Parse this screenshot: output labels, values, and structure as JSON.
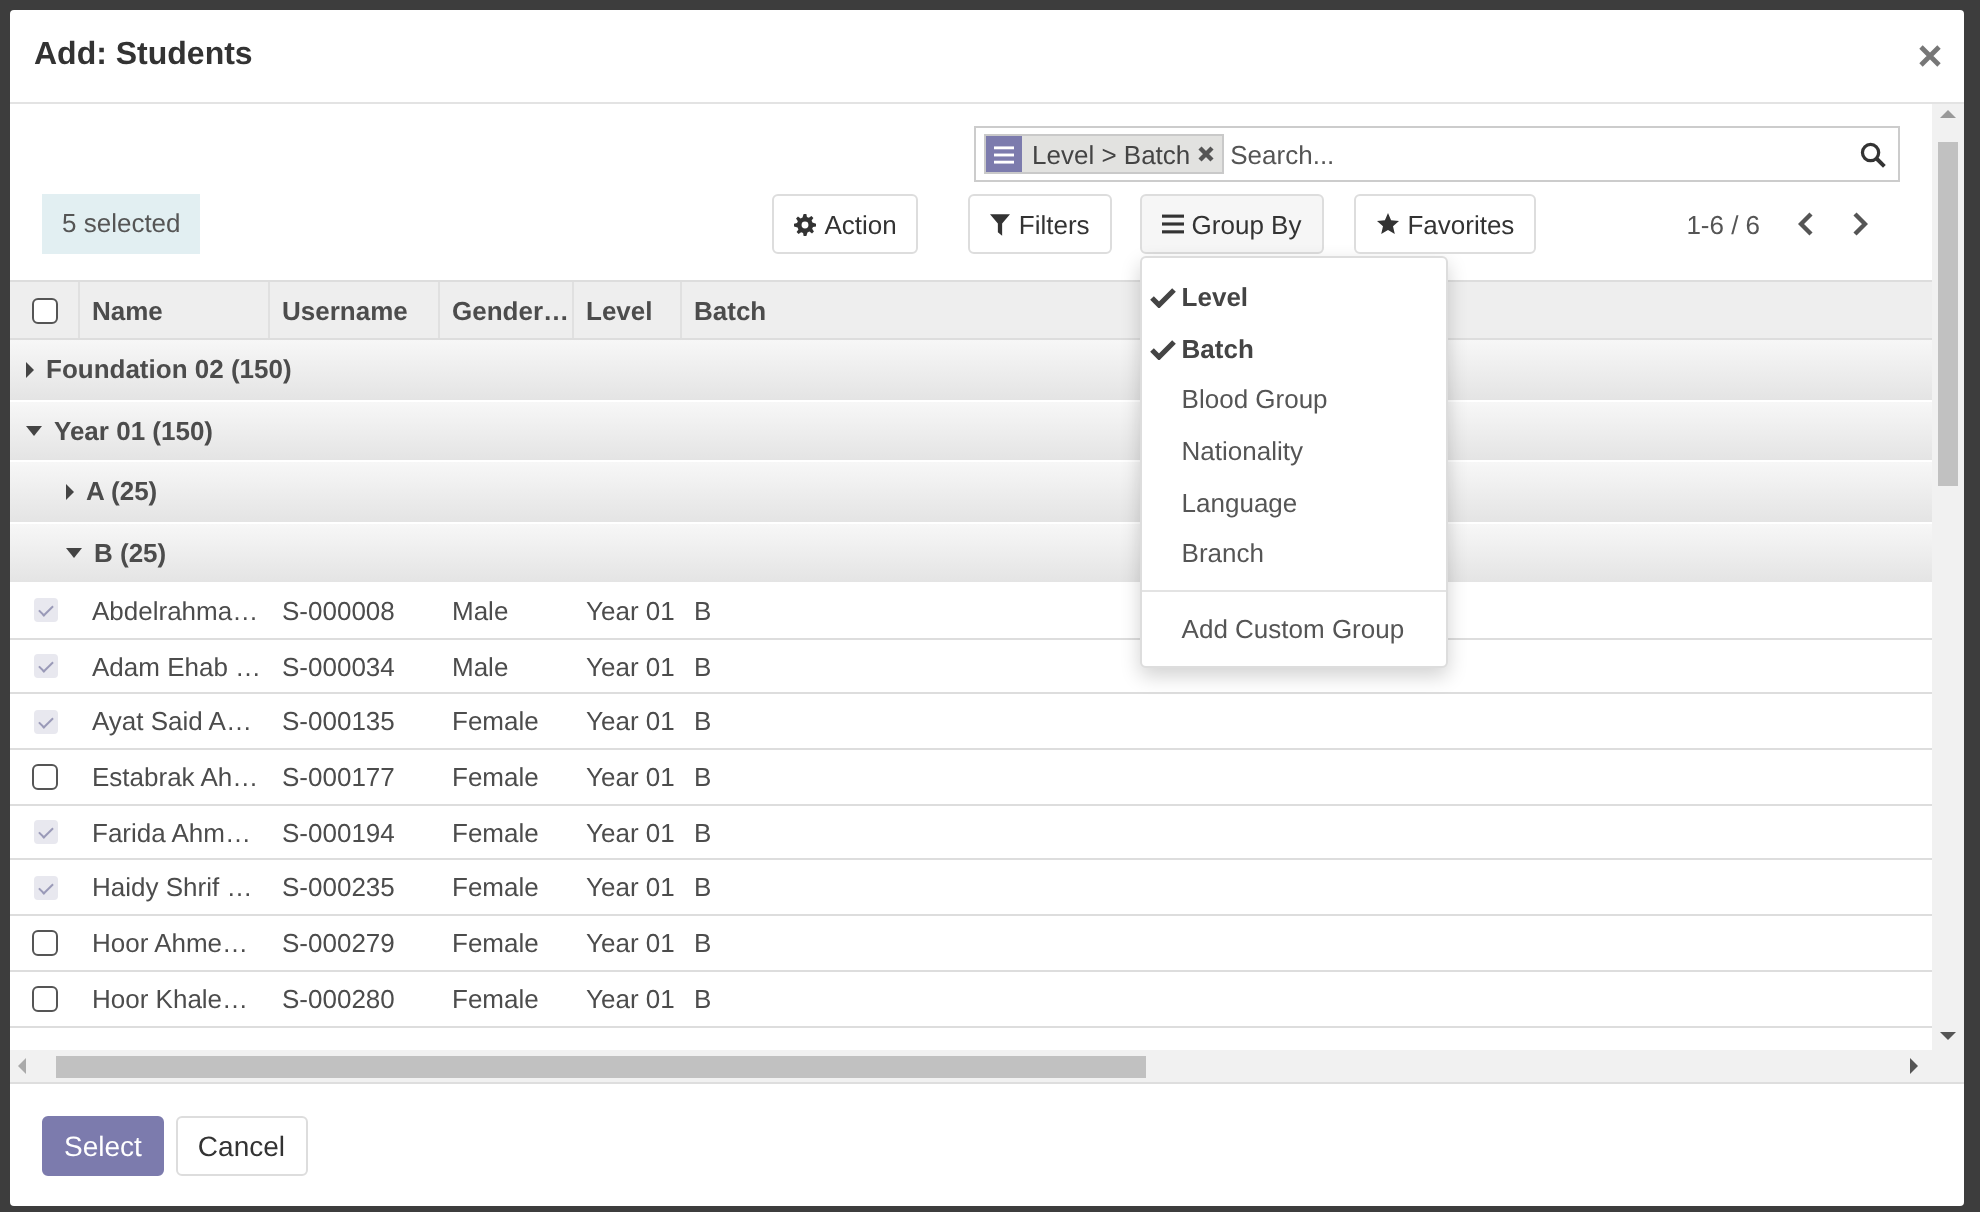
{
  "dialog": {
    "title": "Add: Students"
  },
  "search": {
    "facet": "Level > Batch",
    "placeholder": "Search..."
  },
  "selection": "5 selected",
  "buttons": [
    {
      "label": "Action",
      "kind": "gear",
      "expanded": false
    },
    {
      "label": "Filters",
      "kind": "filter",
      "expanded": false
    },
    {
      "label": "Group By",
      "kind": "menu",
      "expanded": true
    },
    {
      "label": "Favorites",
      "kind": "star",
      "expanded": false
    }
  ],
  "pager": "1-6 / 6",
  "group_by_menu": [
    {
      "label": "Level",
      "kind": "option",
      "checked": true
    },
    {
      "label": "Batch",
      "kind": "option",
      "checked": true
    },
    {
      "label": "Blood Group",
      "kind": "option",
      "checked": false
    },
    {
      "label": "Nationality",
      "kind": "option",
      "checked": false
    },
    {
      "label": "Language",
      "kind": "option",
      "checked": false
    },
    {
      "label": "Branch",
      "kind": "option",
      "checked": false
    },
    {
      "label": "Add Custom Group",
      "kind": "action"
    }
  ],
  "table": {
    "select_all": false,
    "columns": [
      "Name",
      "Username",
      "Gender…",
      "Level",
      "Batch"
    ],
    "groups": [
      {
        "label": "Foundation 02 (150)",
        "expanded": false
      },
      {
        "label": "Year 01 (150)",
        "expanded": true,
        "children": [
          {
            "label": "A (25)",
            "expanded": false
          },
          {
            "label": "B (25)",
            "expanded": true,
            "rows": [
              {
                "checked": true,
                "cells": [
                  "Abdelrahma…",
                  "S-000008",
                  "Male",
                  "Year 01",
                  "B"
                ]
              },
              {
                "checked": true,
                "cells": [
                  "Adam Ehab …",
                  "S-000034",
                  "Male",
                  "Year 01",
                  "B"
                ]
              },
              {
                "checked": true,
                "cells": [
                  "Ayat Said A…",
                  "S-000135",
                  "Female",
                  "Year 01",
                  "B"
                ]
              },
              {
                "checked": false,
                "cells": [
                  "Estabrak Ah…",
                  "S-000177",
                  "Female",
                  "Year 01",
                  "B"
                ]
              },
              {
                "checked": true,
                "cells": [
                  "Farida Ahm…",
                  "S-000194",
                  "Female",
                  "Year 01",
                  "B"
                ]
              },
              {
                "checked": true,
                "cells": [
                  "Haidy Shrif …",
                  "S-000235",
                  "Female",
                  "Year 01",
                  "B"
                ]
              },
              {
                "checked": false,
                "cells": [
                  "Hoor Ahme…",
                  "S-000279",
                  "Female",
                  "Year 01",
                  "B"
                ]
              },
              {
                "checked": false,
                "cells": [
                  "Hoor Khale…",
                  "S-000280",
                  "Female",
                  "Year 01",
                  "B"
                ]
              }
            ]
          }
        ]
      }
    ]
  },
  "footer": [
    {
      "label": "Select",
      "kind": "primary"
    },
    {
      "label": "Cancel",
      "kind": "secondary"
    }
  ]
}
